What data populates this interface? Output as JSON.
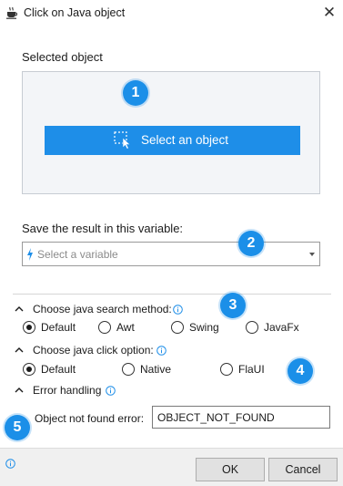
{
  "window": {
    "title": "Click on Java object",
    "close_glyph": "✕",
    "icon": "java-cup-icon"
  },
  "selected_object": {
    "label": "Selected object",
    "button_label": "Select an object",
    "button_icon": "select-cursor-icon"
  },
  "variable": {
    "label": "Save the result in this variable:",
    "placeholder": "Select a variable"
  },
  "search_method": {
    "label": "Choose java search method:",
    "options": [
      "Default",
      "Awt",
      "Swing",
      "JavaFx"
    ],
    "selected": "Default"
  },
  "click_option": {
    "label": "Choose java click option:",
    "options": [
      "Default",
      "Native",
      "FlaUI"
    ],
    "selected": "Default"
  },
  "error_handling": {
    "label": "Error handling",
    "not_found_label": "Object not found error:",
    "not_found_value": "OBJECT_NOT_FOUND"
  },
  "footer": {
    "ok_label": "OK",
    "cancel_label": "Cancel"
  },
  "badges": [
    "1",
    "2",
    "3",
    "4",
    "5"
  ],
  "colors": {
    "accent": "#1e8ee8",
    "badge": "#1b8fe8",
    "info": "#1e8ee8",
    "panel_bg": "#f3f5f8"
  }
}
